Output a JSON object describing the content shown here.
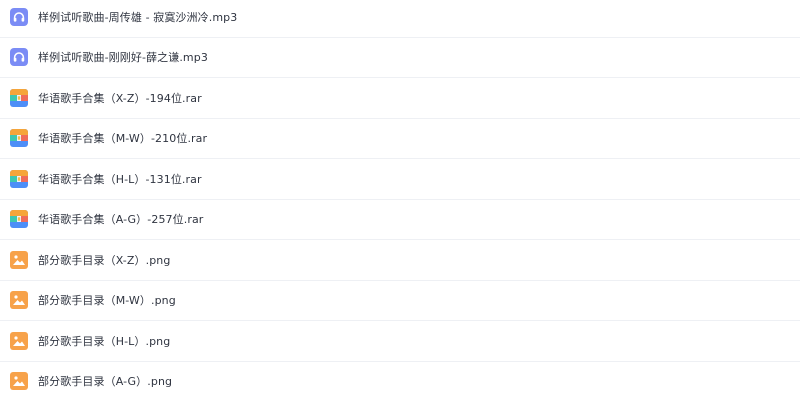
{
  "files": [
    {
      "name": "样例试听歌曲-周传雄 - 寂寞沙洲冷.mp3",
      "type": "audio",
      "icon": "headphones-icon"
    },
    {
      "name": "样例试听歌曲-刚刚好-薛之谦.mp3",
      "type": "audio",
      "icon": "headphones-icon"
    },
    {
      "name": "华语歌手合集（X-Z）-194位.rar",
      "type": "archive",
      "icon": "archive-icon"
    },
    {
      "name": "华语歌手合集（M-W）-210位.rar",
      "type": "archive",
      "icon": "archive-icon"
    },
    {
      "name": "华语歌手合集（H-L）-131位.rar",
      "type": "archive",
      "icon": "archive-icon"
    },
    {
      "name": "华语歌手合集（A-G）-257位.rar",
      "type": "archive",
      "icon": "archive-icon"
    },
    {
      "name": "部分歌手目录（X-Z）.png",
      "type": "image",
      "icon": "image-icon"
    },
    {
      "name": "部分歌手目录（M-W）.png",
      "type": "image",
      "icon": "image-icon"
    },
    {
      "name": "部分歌手目录（H-L）.png",
      "type": "image",
      "icon": "image-icon"
    },
    {
      "name": "部分歌手目录（A-G）.png",
      "type": "image",
      "icon": "image-icon"
    }
  ],
  "colors": {
    "audio": "#7b8cf5",
    "archive_top": "#f5a53a",
    "archive_left": "#3ec7b0",
    "archive_right": "#ef6b5b",
    "archive_bottom": "#4d8ef7",
    "image": "#f7a24a",
    "divider": "#eef0f4",
    "text": "#2f3440"
  }
}
